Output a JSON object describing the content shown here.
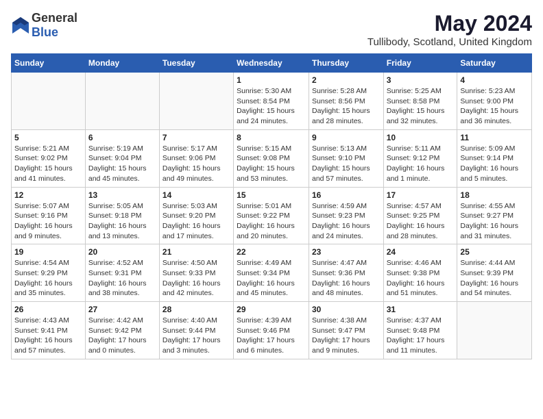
{
  "header": {
    "logo_general": "General",
    "logo_blue": "Blue",
    "title": "May 2024",
    "subtitle": "Tullibody, Scotland, United Kingdom"
  },
  "columns": [
    "Sunday",
    "Monday",
    "Tuesday",
    "Wednesday",
    "Thursday",
    "Friday",
    "Saturday"
  ],
  "weeks": [
    [
      {
        "day": "",
        "info": ""
      },
      {
        "day": "",
        "info": ""
      },
      {
        "day": "",
        "info": ""
      },
      {
        "day": "1",
        "info": "Sunrise: 5:30 AM\nSunset: 8:54 PM\nDaylight: 15 hours\nand 24 minutes."
      },
      {
        "day": "2",
        "info": "Sunrise: 5:28 AM\nSunset: 8:56 PM\nDaylight: 15 hours\nand 28 minutes."
      },
      {
        "day": "3",
        "info": "Sunrise: 5:25 AM\nSunset: 8:58 PM\nDaylight: 15 hours\nand 32 minutes."
      },
      {
        "day": "4",
        "info": "Sunrise: 5:23 AM\nSunset: 9:00 PM\nDaylight: 15 hours\nand 36 minutes."
      }
    ],
    [
      {
        "day": "5",
        "info": "Sunrise: 5:21 AM\nSunset: 9:02 PM\nDaylight: 15 hours\nand 41 minutes."
      },
      {
        "day": "6",
        "info": "Sunrise: 5:19 AM\nSunset: 9:04 PM\nDaylight: 15 hours\nand 45 minutes."
      },
      {
        "day": "7",
        "info": "Sunrise: 5:17 AM\nSunset: 9:06 PM\nDaylight: 15 hours\nand 49 minutes."
      },
      {
        "day": "8",
        "info": "Sunrise: 5:15 AM\nSunset: 9:08 PM\nDaylight: 15 hours\nand 53 minutes."
      },
      {
        "day": "9",
        "info": "Sunrise: 5:13 AM\nSunset: 9:10 PM\nDaylight: 15 hours\nand 57 minutes."
      },
      {
        "day": "10",
        "info": "Sunrise: 5:11 AM\nSunset: 9:12 PM\nDaylight: 16 hours\nand 1 minute."
      },
      {
        "day": "11",
        "info": "Sunrise: 5:09 AM\nSunset: 9:14 PM\nDaylight: 16 hours\nand 5 minutes."
      }
    ],
    [
      {
        "day": "12",
        "info": "Sunrise: 5:07 AM\nSunset: 9:16 PM\nDaylight: 16 hours\nand 9 minutes."
      },
      {
        "day": "13",
        "info": "Sunrise: 5:05 AM\nSunset: 9:18 PM\nDaylight: 16 hours\nand 13 minutes."
      },
      {
        "day": "14",
        "info": "Sunrise: 5:03 AM\nSunset: 9:20 PM\nDaylight: 16 hours\nand 17 minutes."
      },
      {
        "day": "15",
        "info": "Sunrise: 5:01 AM\nSunset: 9:22 PM\nDaylight: 16 hours\nand 20 minutes."
      },
      {
        "day": "16",
        "info": "Sunrise: 4:59 AM\nSunset: 9:23 PM\nDaylight: 16 hours\nand 24 minutes."
      },
      {
        "day": "17",
        "info": "Sunrise: 4:57 AM\nSunset: 9:25 PM\nDaylight: 16 hours\nand 28 minutes."
      },
      {
        "day": "18",
        "info": "Sunrise: 4:55 AM\nSunset: 9:27 PM\nDaylight: 16 hours\nand 31 minutes."
      }
    ],
    [
      {
        "day": "19",
        "info": "Sunrise: 4:54 AM\nSunset: 9:29 PM\nDaylight: 16 hours\nand 35 minutes."
      },
      {
        "day": "20",
        "info": "Sunrise: 4:52 AM\nSunset: 9:31 PM\nDaylight: 16 hours\nand 38 minutes."
      },
      {
        "day": "21",
        "info": "Sunrise: 4:50 AM\nSunset: 9:33 PM\nDaylight: 16 hours\nand 42 minutes."
      },
      {
        "day": "22",
        "info": "Sunrise: 4:49 AM\nSunset: 9:34 PM\nDaylight: 16 hours\nand 45 minutes."
      },
      {
        "day": "23",
        "info": "Sunrise: 4:47 AM\nSunset: 9:36 PM\nDaylight: 16 hours\nand 48 minutes."
      },
      {
        "day": "24",
        "info": "Sunrise: 4:46 AM\nSunset: 9:38 PM\nDaylight: 16 hours\nand 51 minutes."
      },
      {
        "day": "25",
        "info": "Sunrise: 4:44 AM\nSunset: 9:39 PM\nDaylight: 16 hours\nand 54 minutes."
      }
    ],
    [
      {
        "day": "26",
        "info": "Sunrise: 4:43 AM\nSunset: 9:41 PM\nDaylight: 16 hours\nand 57 minutes."
      },
      {
        "day": "27",
        "info": "Sunrise: 4:42 AM\nSunset: 9:42 PM\nDaylight: 17 hours\nand 0 minutes."
      },
      {
        "day": "28",
        "info": "Sunrise: 4:40 AM\nSunset: 9:44 PM\nDaylight: 17 hours\nand 3 minutes."
      },
      {
        "day": "29",
        "info": "Sunrise: 4:39 AM\nSunset: 9:46 PM\nDaylight: 17 hours\nand 6 minutes."
      },
      {
        "day": "30",
        "info": "Sunrise: 4:38 AM\nSunset: 9:47 PM\nDaylight: 17 hours\nand 9 minutes."
      },
      {
        "day": "31",
        "info": "Sunrise: 4:37 AM\nSunset: 9:48 PM\nDaylight: 17 hours\nand 11 minutes."
      },
      {
        "day": "",
        "info": ""
      }
    ]
  ]
}
